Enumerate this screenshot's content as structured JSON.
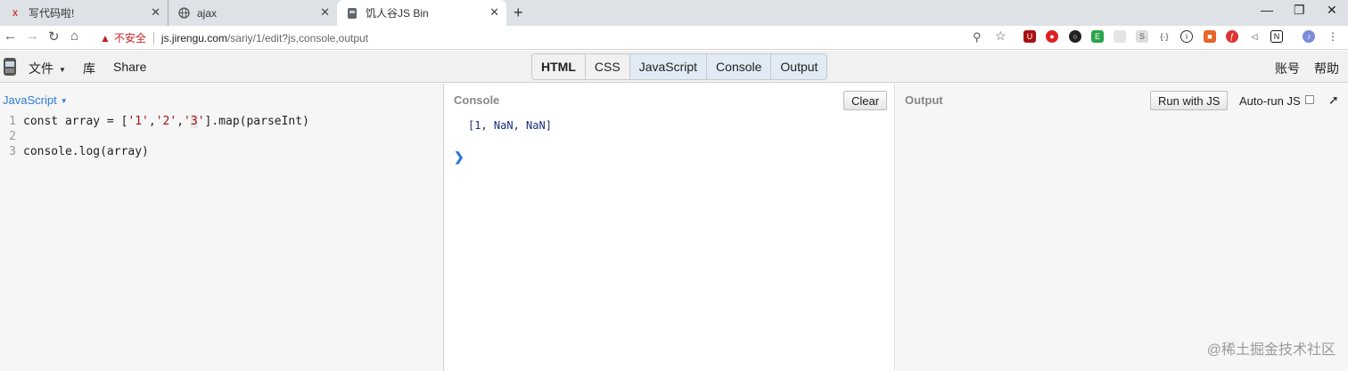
{
  "browser": {
    "tabs": [
      {
        "title": "写代码啦!",
        "favicon": "xiedaima-icon"
      },
      {
        "title": "ajax",
        "favicon": "globe-icon"
      },
      {
        "title": "饥人谷JS Bin",
        "favicon": "jsbin-icon"
      }
    ],
    "url": {
      "security_label": "不安全",
      "host": "js.jirengu.com",
      "path": "/sariy/1/edit?js,console,output"
    },
    "extension_icons": [
      "ublock-icon",
      "adblock-icon",
      "recorder-icon",
      "evernote-icon",
      "blank-icon",
      "s-icon",
      "code-icon",
      "info-icon",
      "extension-orange-icon",
      "flash-icon",
      "speaker-icon",
      "notion-icon",
      "profile-avatar-icon",
      "kebab-menu-icon"
    ]
  },
  "jsbin": {
    "menu": {
      "file": "文件",
      "library": "库",
      "share": "Share",
      "account": "账号",
      "help": "帮助"
    },
    "panels": [
      "HTML",
      "CSS",
      "JavaScript",
      "Console",
      "Output"
    ],
    "active_panels": [
      "JavaScript",
      "Console",
      "Output"
    ]
  },
  "editor": {
    "language_label": "JavaScript",
    "lines": [
      {
        "num": "1",
        "text": "const array = ['1','2','3'].map(parseInt)"
      },
      {
        "num": "2",
        "text": ""
      },
      {
        "num": "3",
        "text": "console.log(array)"
      }
    ]
  },
  "console": {
    "label": "Console",
    "clear_label": "Clear",
    "output": "[1, NaN, NaN]",
    "prompt": "❯"
  },
  "output": {
    "label": "Output",
    "run_label": "Run with JS",
    "autorun_label": "Auto-run JS"
  },
  "watermark": "@稀土掘金技术社区",
  "colors": {
    "accent": "#2b7bd6",
    "warning": "#c5221f",
    "active_panel": "#e1ebf5"
  }
}
